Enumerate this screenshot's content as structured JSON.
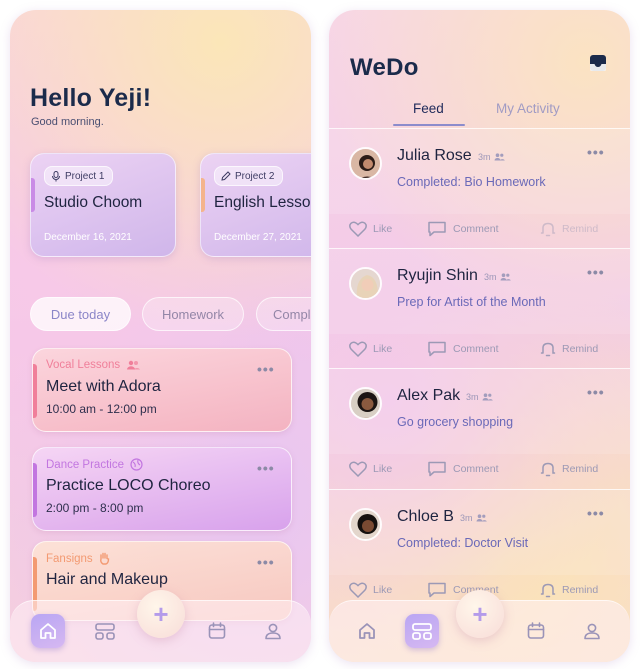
{
  "left": {
    "greeting": "Hello Yeji!",
    "subgreeting": "Good morning.",
    "projects": [
      {
        "tag": "Project 1",
        "icon": "microphone-icon",
        "title": "Studio Choom",
        "date": "December 16, 2021",
        "accent": "#c98be6"
      },
      {
        "tag": "Project 2",
        "icon": "pencil-icon",
        "title": "English Lesson",
        "date": "December 27, 2021",
        "accent": "#f4b48c"
      }
    ],
    "filters": [
      "Due today",
      "Homework",
      "Completed"
    ],
    "tasks": [
      {
        "category": "Vocal Lessons",
        "title": "Meet with Adora",
        "time": "10:00 am - 12:00 pm",
        "color": "#f07f9a"
      },
      {
        "category": "Dance Practice",
        "title": "Practice LOCO Choreo",
        "time": "2:00 pm - 8:00 pm",
        "color": "#c276e0"
      },
      {
        "category": "Fansigns",
        "title": "Hair and Makeup",
        "time": "",
        "color": "#f39a72"
      }
    ],
    "more_label": "•••",
    "add_label": "+"
  },
  "right": {
    "title": "WeDo",
    "tabs": [
      "Feed",
      "My Activity"
    ],
    "posts": [
      {
        "name": "Julia Rose",
        "ago": "3m",
        "text": "Completed: Bio Homework",
        "remind_enabled": false
      },
      {
        "name": "Ryujin Shin",
        "ago": "3m",
        "text": "Prep for Artist of the Month",
        "remind_enabled": true
      },
      {
        "name": "Alex Pak",
        "ago": "3m",
        "text": "Go grocery shopping",
        "remind_enabled": true
      },
      {
        "name": "Chloe B",
        "ago": "3m",
        "text": "Completed: Doctor Visit",
        "remind_enabled": true
      }
    ],
    "actions": {
      "like": "Like",
      "comment": "Comment",
      "remind": "Remind"
    },
    "more_label": "•••",
    "add_label": "+"
  },
  "colors": {
    "accent": "#8c8ccc",
    "heading": "#1b2b4b",
    "link": "#6a69b8"
  }
}
